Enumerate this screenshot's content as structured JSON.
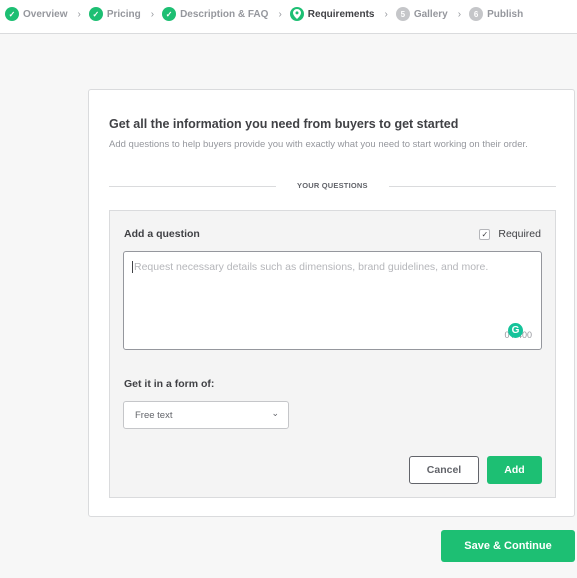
{
  "steps": [
    {
      "label": "Overview",
      "state": "done",
      "icon": "check-icon",
      "glyph": "✓"
    },
    {
      "label": "Pricing",
      "state": "done",
      "icon": "check-icon",
      "glyph": "✓"
    },
    {
      "label": "Description & FAQ",
      "state": "done",
      "icon": "check-icon",
      "glyph": "✓"
    },
    {
      "label": "Requirements",
      "state": "current",
      "icon": "location-pin-icon",
      "glyph": "●"
    },
    {
      "label": "Gallery",
      "state": "pending",
      "icon": "step-number-icon",
      "glyph": "5"
    },
    {
      "label": "Publish",
      "state": "pending",
      "icon": "step-number-icon",
      "glyph": "6"
    }
  ],
  "step_separator": "›",
  "card": {
    "title": "Get all the information you need from buyers to get started",
    "description": "Add questions to help buyers provide you with exactly what you need to start working on their order.",
    "section_label": "YOUR QUESTIONS"
  },
  "question_form": {
    "label": "Add a question",
    "required_label": "Required",
    "required_checked": true,
    "checkmark": "✓",
    "textarea_placeholder": "Request necessary details such as dimensions, brand guidelines, and more.",
    "textarea_value": "",
    "char_counter": "0 / 400",
    "grammarly_glyph": "G",
    "form_label": "Get it in a form of:",
    "answer_type": "Free text",
    "chevron": "⌄",
    "cancel_label": "Cancel",
    "add_label": "Add"
  },
  "footer": {
    "save_label": "Save & Continue"
  },
  "colors": {
    "accent": "#1dbf73",
    "pending": "#c5c6c9",
    "text_dark": "#404145",
    "text_muted": "#95979d"
  }
}
